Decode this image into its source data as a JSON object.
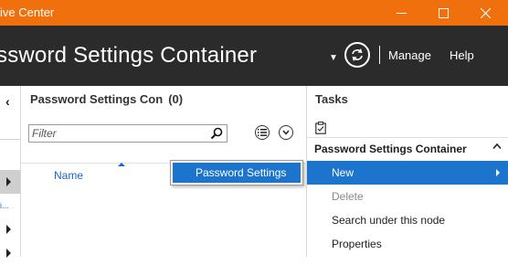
{
  "window": {
    "title": "ive Center",
    "controls": [
      "minimize-icon",
      "maximize-icon",
      "close-icon"
    ],
    "titlebar_color": "#f0700e"
  },
  "header": {
    "title": "ssword Settings Container",
    "menu": {
      "manage": "Manage",
      "help": "Help"
    },
    "icons": [
      "dropdown-arrow-icon",
      "refresh-icon"
    ],
    "background": "#2b2b2b"
  },
  "left_nav": {
    "truncated_item": "i..."
  },
  "main": {
    "pane_title": "Password Settings Con",
    "count": "(0)",
    "filter": {
      "placeholder": "Filter",
      "value": ""
    },
    "columns": [
      "Name"
    ],
    "flyout": {
      "item": "Password Settings"
    }
  },
  "tasks": {
    "title": "Tasks",
    "section": "Password Settings Container",
    "items": [
      {
        "label": "New",
        "state": "active",
        "has_submenu": true
      },
      {
        "label": "Delete",
        "state": "disabled"
      },
      {
        "label": "Search under this node",
        "state": "normal"
      },
      {
        "label": "Properties",
        "state": "normal"
      }
    ],
    "accent": "#1d74cc"
  }
}
